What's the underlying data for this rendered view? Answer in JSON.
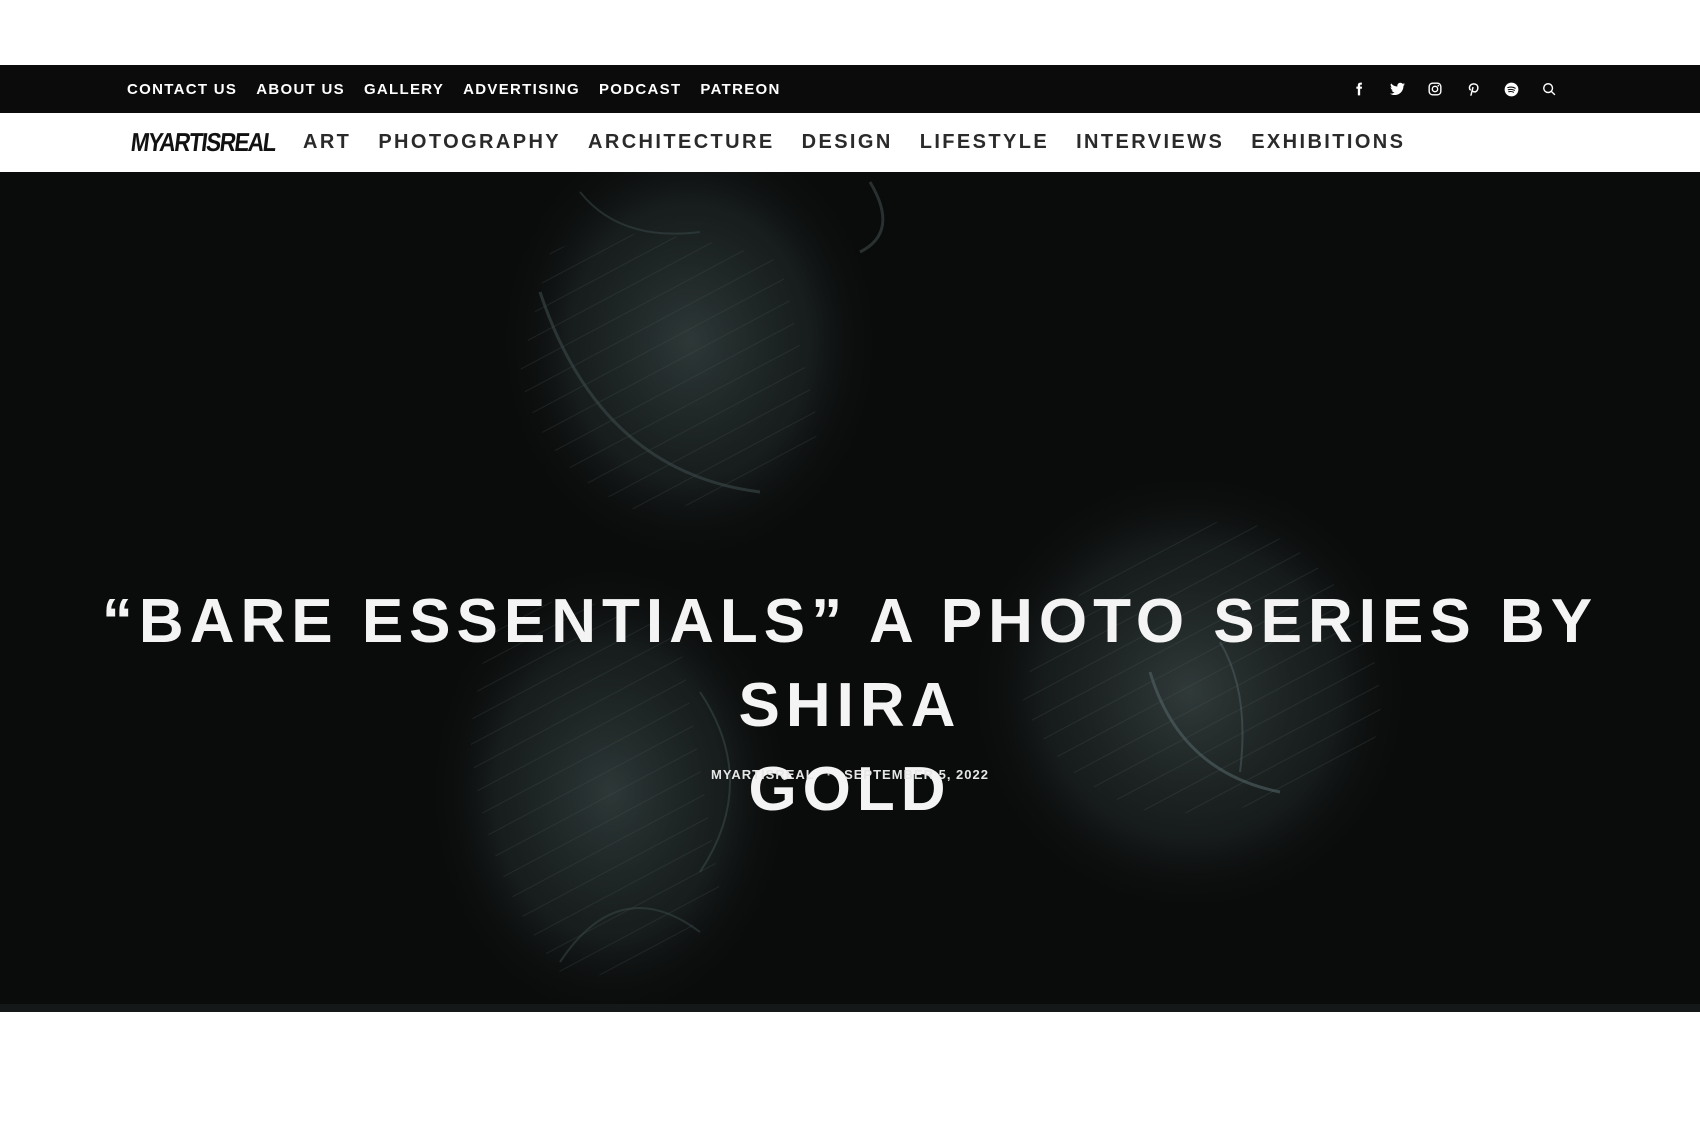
{
  "topbar": {
    "links": [
      "CONTACT US",
      "ABOUT US",
      "GALLERY",
      "ADVERTISING",
      "PODCAST",
      "PATREON"
    ],
    "icons": [
      "facebook-icon",
      "twitter-icon",
      "instagram-icon",
      "pinterest-icon",
      "spotify-icon",
      "search-icon"
    ]
  },
  "nav": {
    "logo": "MYARTISREAL",
    "items": [
      "ART",
      "PHOTOGRAPHY",
      "ARCHITECTURE",
      "DESIGN",
      "LIFESTYLE",
      "INTERVIEWS",
      "EXHIBITIONS"
    ]
  },
  "hero": {
    "title_line1": "“BARE ESSENTIALS” A PHOTO SERIES BY SHIRA",
    "title_line2": "GOLD",
    "author": "MYARTISREAL",
    "separator": "·",
    "date": "SEPTEMBER 5, 2022"
  },
  "colors": {
    "topbar_bg": "#0b0b0b",
    "hero_bg": "#0a0b0b",
    "mask_tint": "#2b3535"
  }
}
